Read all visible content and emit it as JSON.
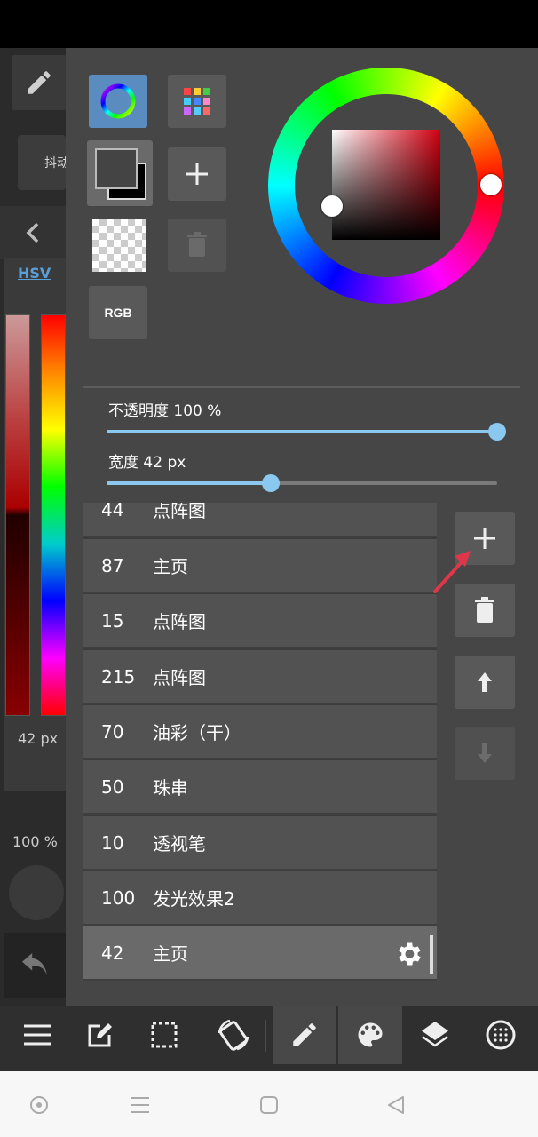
{
  "underlay": {
    "tab_partial": "抖动",
    "color_mode": "HSV",
    "size_label": "42 px",
    "opacity_label": "100 %"
  },
  "color_panel": {
    "rgb_button_label": "RGB",
    "foreground_color": "#444444",
    "background_color": "#000000",
    "hue_color": "#d00010",
    "accent_color": "#8ac8f0"
  },
  "sliders": {
    "opacity": {
      "label": "不透明度 100 %",
      "value_percent": 100
    },
    "width": {
      "label": "宽度 42 px",
      "value_percent": 42
    }
  },
  "brush_list": [
    {
      "size": "44",
      "name": "点阵图"
    },
    {
      "size": "87",
      "name": "主页"
    },
    {
      "size": "15",
      "name": "点阵图"
    },
    {
      "size": "215",
      "name": "点阵图"
    },
    {
      "size": "70",
      "name": "油彩（干）"
    },
    {
      "size": "50",
      "name": "珠串"
    },
    {
      "size": "10",
      "name": "透视笔"
    },
    {
      "size": "100",
      "name": "发光效果2"
    },
    {
      "size": "42",
      "name": "主页",
      "selected": true
    }
  ],
  "toolbar_icons": [
    "menu-icon",
    "edit-square-icon",
    "selection-icon",
    "rotate-screen-icon",
    "pen-icon",
    "palette-icon",
    "layers-icon",
    "material-icon"
  ],
  "navbar_icons": [
    "home-circle-icon",
    "recents-icon",
    "square-icon",
    "back-triangle-icon"
  ]
}
